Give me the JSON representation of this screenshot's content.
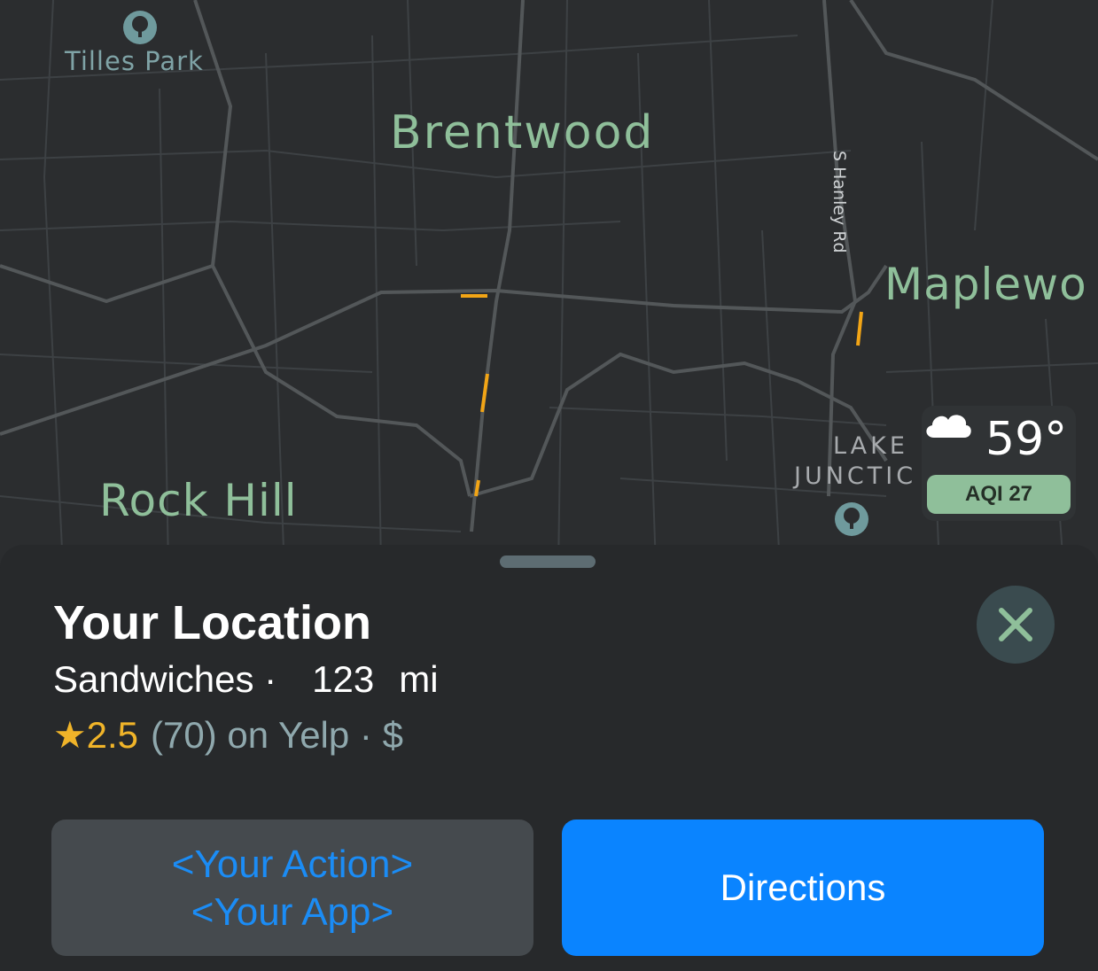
{
  "map": {
    "labels": {
      "brentwood": "Brentwood",
      "rock_hill": "Rock Hill",
      "maplewood": "Maplewo",
      "tilles_park": "Tilles Park",
      "lake": "LAKE",
      "junction": "JUNCTIC",
      "hanley": "S Hanley Rd"
    },
    "icons": {
      "park": "tree-icon",
      "weather": "cloud-icon",
      "close": "close-icon"
    }
  },
  "weather": {
    "temp": "59°",
    "aqi": "AQI 27"
  },
  "place": {
    "title": "Your Location",
    "category": "Sandwiches ·",
    "distance": "123",
    "unit": "mi",
    "star": "★",
    "rating": "2.5",
    "reviews": "(70) on Yelp · $"
  },
  "buttons": {
    "action_line1": "<Your Action>",
    "action_line2": "<Your App>",
    "directions": "Directions"
  },
  "colors": {
    "map_label": "#8fbf9a",
    "rating": "#f0b429",
    "accent": "#0a84ff"
  }
}
